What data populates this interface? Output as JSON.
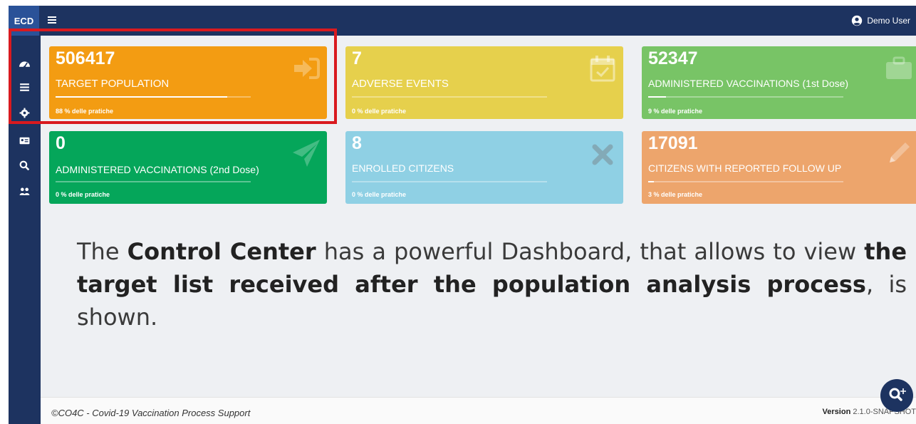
{
  "app": {
    "brand": "ECD",
    "user": "Demo User"
  },
  "sidebar": {
    "icons": [
      "dashboard-icon",
      "list-icon",
      "gear-icon",
      "id-card-icon",
      "search-icon",
      "users-icon"
    ]
  },
  "cards": [
    {
      "value": "506417",
      "label": "TARGET POPULATION",
      "sub": "88 % delle pratiche",
      "progress": 0.88,
      "color": "#f39c12",
      "icon": "sign-in-icon"
    },
    {
      "value": "7",
      "label": "ADVERSE EVENTS",
      "sub": "0 % delle pratiche",
      "progress": 0,
      "color": "#e6d04c",
      "icon": "calendar-check-icon"
    },
    {
      "value": "52347",
      "label": "ADMINISTERED VACCINATIONS (1st Dose)",
      "sub": "9 % delle pratiche",
      "progress": 0.09,
      "color": "#78c466",
      "icon": "briefcase-icon"
    },
    {
      "value": "0",
      "label": "ADMINISTERED VACCINATIONS (2nd Dose)",
      "sub": "0 % delle pratiche",
      "progress": 0,
      "color": "#05a65a",
      "icon": "paper-plane-icon"
    },
    {
      "value": "8",
      "label": "ENROLLED CITIZENS",
      "sub": "0 % delle pratiche",
      "progress": 0,
      "color": "#8fd0e4",
      "icon": "times-icon"
    },
    {
      "value": "17091",
      "label": "CITIZENS WITH REPORTED FOLLOW UP",
      "sub": "3 % delle pratiche",
      "progress": 0.03,
      "color": "#eda56c",
      "icon": "pencil-icon"
    }
  ],
  "caption": {
    "p1": "The ",
    "b1": "Control Center",
    "p2": " has a powerful Dashboard, that allows to view ",
    "b2": "the target list received after the population analysis process",
    "p3": ", is shown."
  },
  "footer": {
    "left": "©CO4C - Covid-19 Vaccination Process Support",
    "version_label": "Version",
    "version": "2.1.0-SNAPSHOT"
  },
  "colors": {
    "navy": "#1d3360",
    "brand_bg": "#2a5298",
    "highlight": "#d91a1f"
  }
}
